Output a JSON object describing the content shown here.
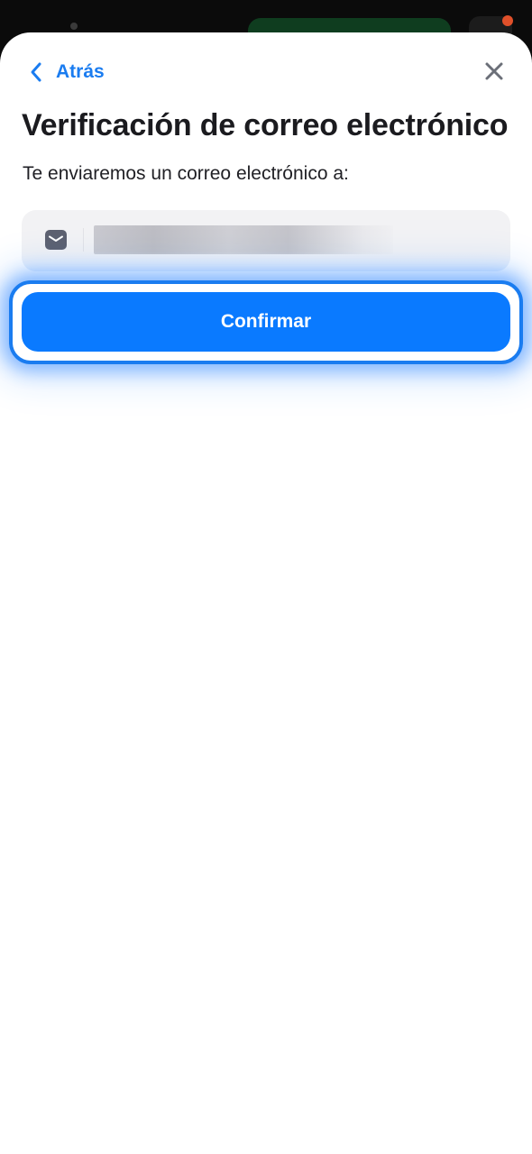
{
  "sheet": {
    "back_label": "Atrás",
    "title": "Verificación de correo electrónico",
    "subtitle": "Te enviaremos un correo electrónico a:"
  },
  "email_field": {
    "icon": "mail-icon",
    "value": ""
  },
  "actions": {
    "confirm_label": "Confirmar"
  },
  "colors": {
    "accent": "#0a7aff",
    "link": "#1a7cf0",
    "title": "#1b1b1f",
    "field_bg": "#f2f2f4"
  }
}
